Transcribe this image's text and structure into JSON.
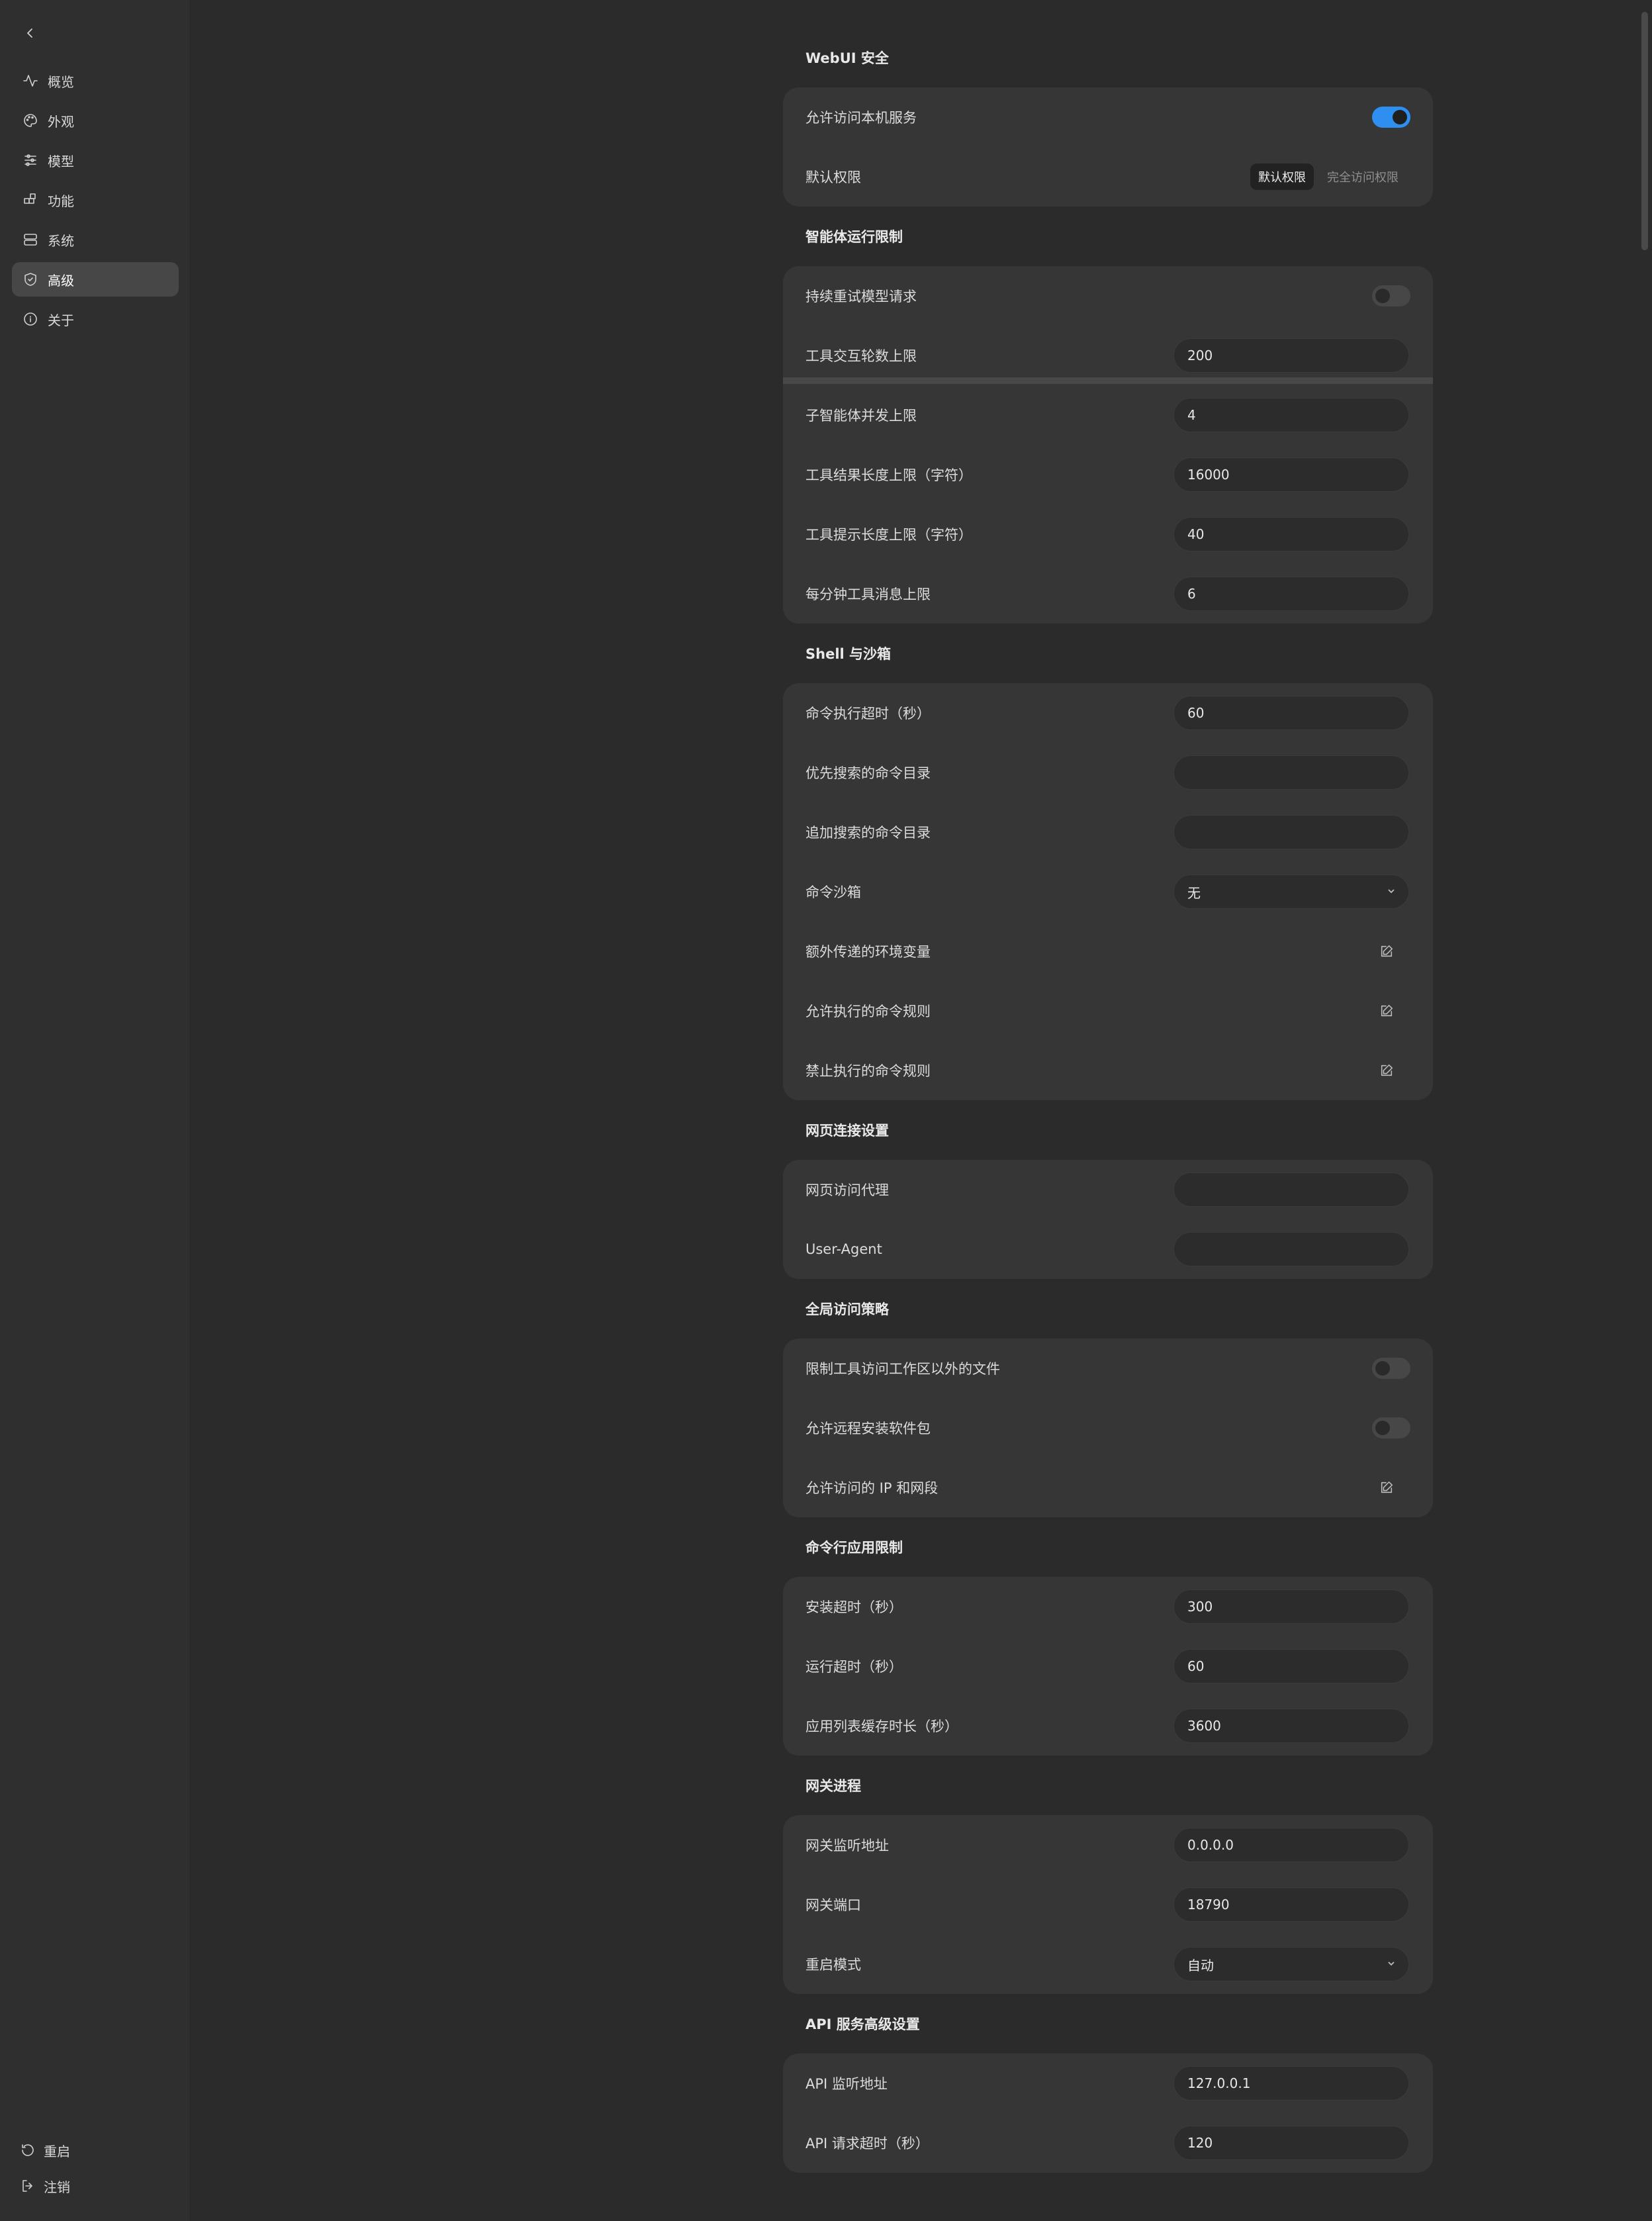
{
  "sidebar": {
    "items": [
      {
        "label": "概览",
        "icon": "activity-icon"
      },
      {
        "label": "外观",
        "icon": "palette-icon"
      },
      {
        "label": "模型",
        "icon": "sliders-icon"
      },
      {
        "label": "功能",
        "icon": "blocks-icon"
      },
      {
        "label": "系统",
        "icon": "server-icon"
      },
      {
        "label": "高级",
        "icon": "shield-icon",
        "active": true
      },
      {
        "label": "关于",
        "icon": "info-icon"
      }
    ],
    "footer": {
      "restart": "重启",
      "logout": "注销"
    }
  },
  "sections": {
    "webui": {
      "title": "WebUI 安全",
      "allow_local": {
        "label": "允许访问本机服务",
        "on": true
      },
      "default_perm": {
        "label": "默认权限",
        "options": [
          "默认权限",
          "完全访问权限"
        ],
        "selected": "默认权限"
      }
    },
    "agent": {
      "title": "智能体运行限制",
      "retry": {
        "label": "持续重试模型请求",
        "on": false
      },
      "tool_turns": {
        "label": "工具交互轮数上限",
        "value": "200"
      },
      "sub_agents": {
        "label": "子智能体并发上限",
        "value": "4"
      },
      "result_len": {
        "label": "工具结果长度上限（字符）",
        "value": "16000"
      },
      "hint_len": {
        "label": "工具提示长度上限（字符）",
        "value": "40"
      },
      "msg_per_min": {
        "label": "每分钟工具消息上限",
        "value": "6"
      }
    },
    "shell": {
      "title": "Shell 与沙箱",
      "timeout": {
        "label": "命令执行超时（秒）",
        "value": "60"
      },
      "prior_dirs": {
        "label": "优先搜索的命令目录",
        "value": ""
      },
      "extra_dirs": {
        "label": "追加搜索的命令目录",
        "value": ""
      },
      "sandbox": {
        "label": "命令沙箱",
        "value": "无"
      },
      "env": {
        "label": "额外传递的环境变量"
      },
      "allow_rules": {
        "label": "允许执行的命令规则"
      },
      "deny_rules": {
        "label": "禁止执行的命令规则"
      }
    },
    "web": {
      "title": "网页连接设置",
      "proxy": {
        "label": "网页访问代理",
        "value": ""
      },
      "ua": {
        "label": "User-Agent",
        "value": ""
      }
    },
    "access": {
      "title": "全局访问策略",
      "restrict": {
        "label": "限制工具访问工作区以外的文件",
        "on": false
      },
      "remote_install": {
        "label": "允许远程安装软件包",
        "on": false
      },
      "ips": {
        "label": "允许访问的 IP 和网段"
      }
    },
    "cli": {
      "title": "命令行应用限制",
      "install_timeout": {
        "label": "安装超时（秒）",
        "value": "300"
      },
      "run_timeout": {
        "label": "运行超时（秒）",
        "value": "60"
      },
      "cache": {
        "label": "应用列表缓存时长（秒）",
        "value": "3600"
      }
    },
    "gateway": {
      "title": "网关进程",
      "host": {
        "label": "网关监听地址",
        "value": "0.0.0.0"
      },
      "port": {
        "label": "网关端口",
        "value": "18790"
      },
      "restart": {
        "label": "重启模式",
        "value": "自动"
      }
    },
    "api": {
      "title": "API 服务高级设置",
      "host": {
        "label": "API 监听地址",
        "value": "127.0.0.1"
      },
      "timeout": {
        "label": "API 请求超时（秒）",
        "value": "120"
      }
    }
  },
  "colors": {
    "accent": "#2f8ff0",
    "background": "#2b2b2b",
    "card": "#363636"
  }
}
